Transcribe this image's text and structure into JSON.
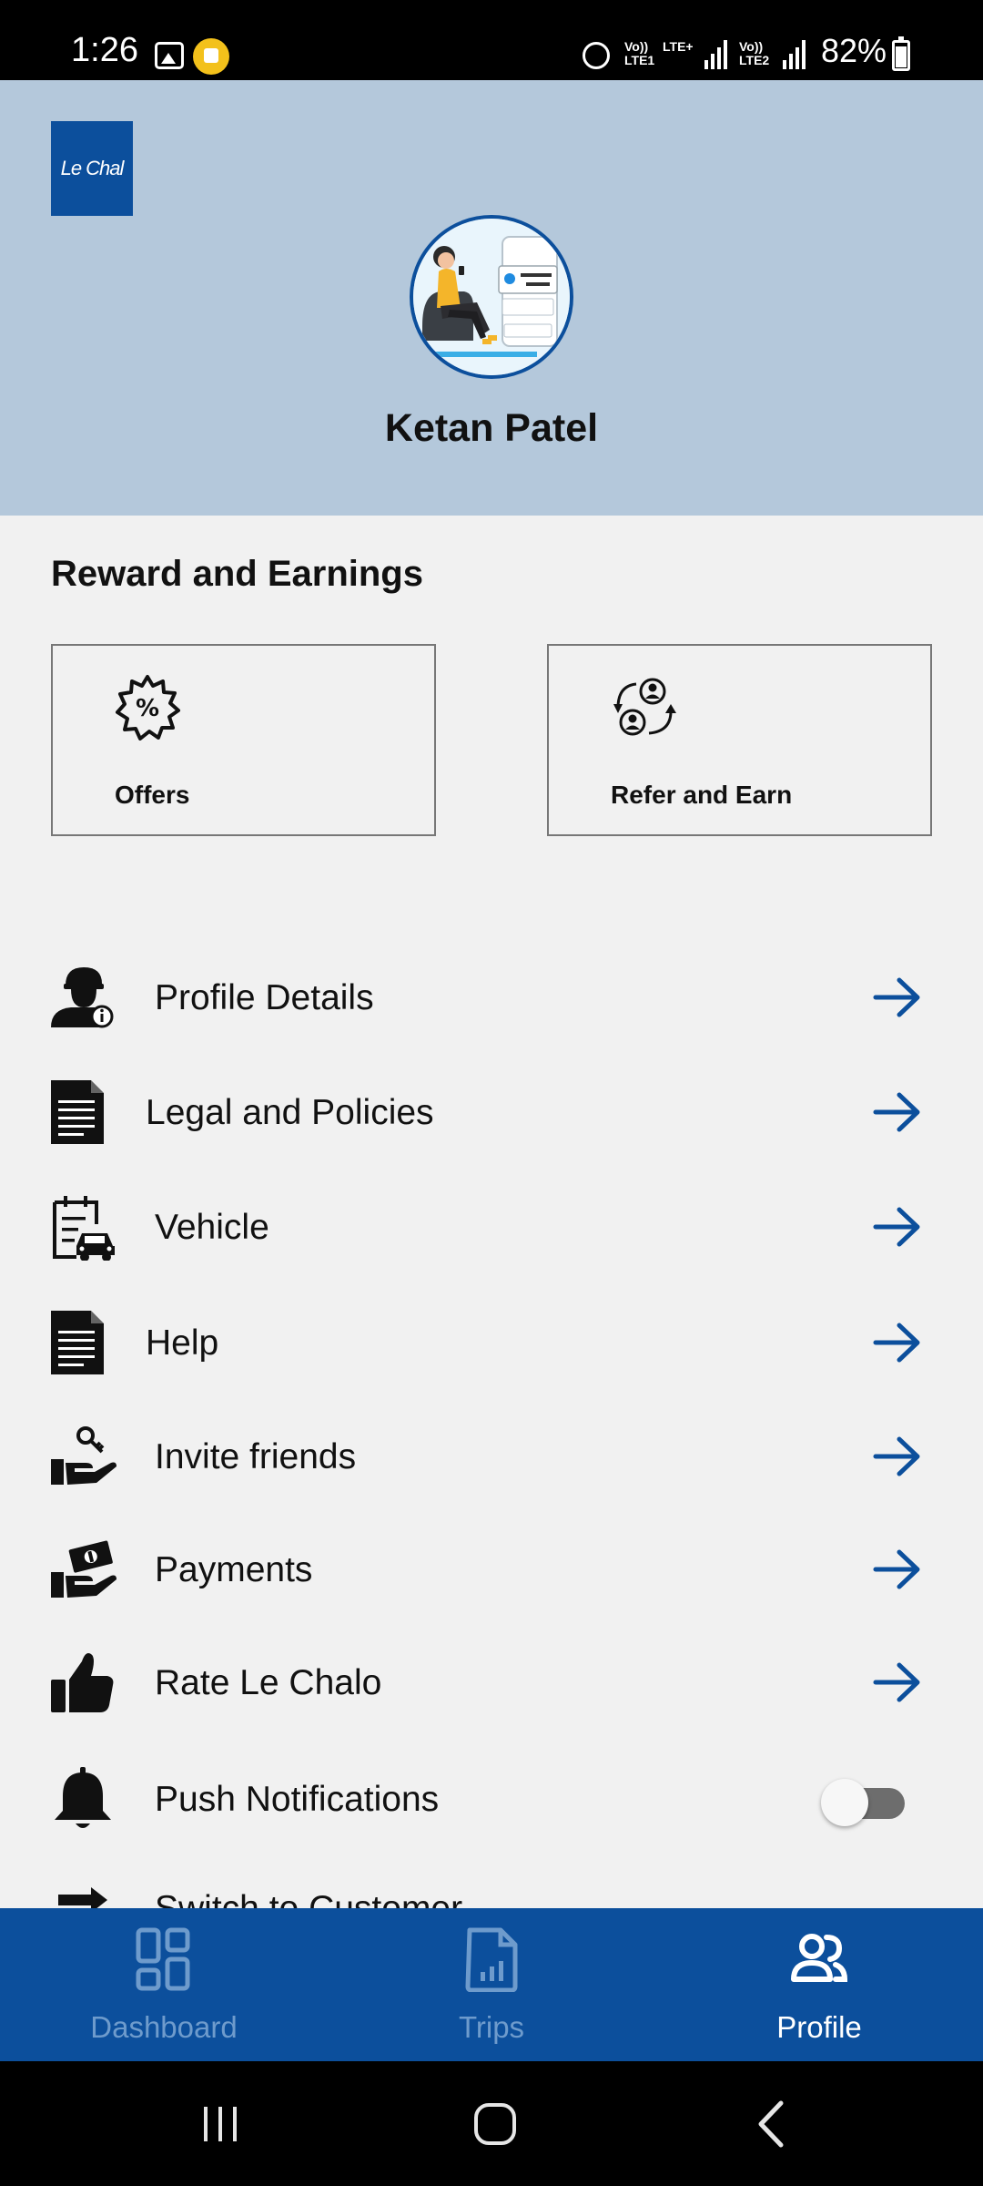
{
  "status_bar": {
    "time": "1:26",
    "net1_top": "Vo))",
    "net1_bottom": "LTE1",
    "net1_extra": "LTE+",
    "net2_top": "Vo))",
    "net2_bottom": "LTE2",
    "battery": "82%"
  },
  "header": {
    "logo_text": "Le Chal",
    "user_name": "Ketan Patel",
    "bg_color": "#b4c8db",
    "brand_color": "#0c4f9c"
  },
  "rewards": {
    "title": "Reward and Earnings",
    "cards": [
      {
        "label": "Offers",
        "icon": "percent-badge-icon"
      },
      {
        "label": "Refer and Earn",
        "icon": "refer-exchange-icon"
      }
    ]
  },
  "menu": {
    "items": [
      {
        "label": "Profile Details",
        "icon": "user-info-icon"
      },
      {
        "label": "Legal and Policies",
        "icon": "document-icon"
      },
      {
        "label": "Vehicle",
        "icon": "vehicle-clipboard-icon"
      },
      {
        "label": "Help",
        "icon": "document-icon"
      },
      {
        "label": "Invite friends",
        "icon": "hand-key-icon"
      },
      {
        "label": "Payments",
        "icon": "hand-money-icon"
      },
      {
        "label": "Rate Le Chalo",
        "icon": "thumbs-up-icon"
      },
      {
        "label": "Push Notifications",
        "icon": "bell-icon",
        "toggle": false
      },
      {
        "label": "Switch to Customer",
        "icon": "switch-arrows-icon"
      }
    ]
  },
  "bottom_nav": {
    "items": [
      {
        "label": "Dashboard",
        "icon": "dashboard-grid-icon",
        "active": false
      },
      {
        "label": "Trips",
        "icon": "trips-chart-icon",
        "active": false
      },
      {
        "label": "Profile",
        "icon": "profile-users-icon",
        "active": true
      }
    ]
  }
}
